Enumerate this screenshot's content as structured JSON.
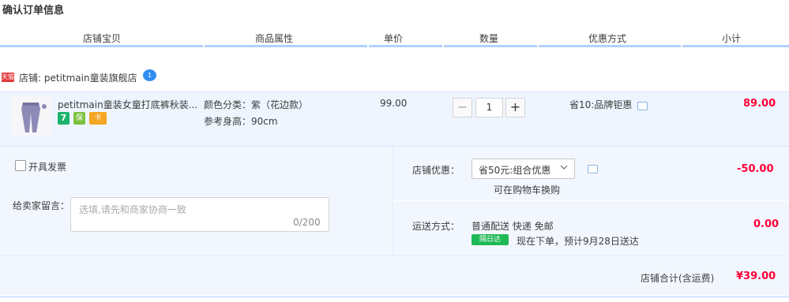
{
  "page_title": "确认订单信息",
  "columns": [
    "店铺宝贝",
    "商品属性",
    "单价",
    "数量",
    "优惠方式",
    "小计"
  ],
  "shop": {
    "badge": "天猫",
    "label": "店铺: petitmain童装旗舰店",
    "chat_badge": "1"
  },
  "item": {
    "title": "petitmain童装女童打底裤秋装...",
    "services": [
      "7",
      "保",
      "卡"
    ],
    "props": [
      "颜色分类：紫（花边款）",
      "参考身高：90cm"
    ],
    "unit_price": "99.00",
    "quantity": {
      "minus": "−",
      "value": "1",
      "plus": "+"
    },
    "discount": "省10:品牌钜惠",
    "subtotal": "89.00"
  },
  "invoice": {
    "label": "开具发票",
    "checked": false
  },
  "message": {
    "label": "给卖家留言：",
    "placeholder": "选填,请先和商家协商一致",
    "counter": "0/200"
  },
  "shop_discount": {
    "label": "店铺优惠：",
    "selected": "省50元:组合优惠",
    "note": "可在购物车换购",
    "amount": "-50.00"
  },
  "shipping": {
    "label": "运送方式：",
    "method": "普通配送 快递 免邮",
    "badge": "隔日达",
    "note": "现在下单，预计9月28日送达",
    "amount": "0.00"
  },
  "total": {
    "label": "店铺合计(含运费)",
    "amount": "¥39.00"
  },
  "colors": {
    "accent_blue": "#b2d1ff",
    "price_red": "#ff0036",
    "row_bg": "#eef5ff",
    "panel_bg": "#f2f7ff"
  }
}
